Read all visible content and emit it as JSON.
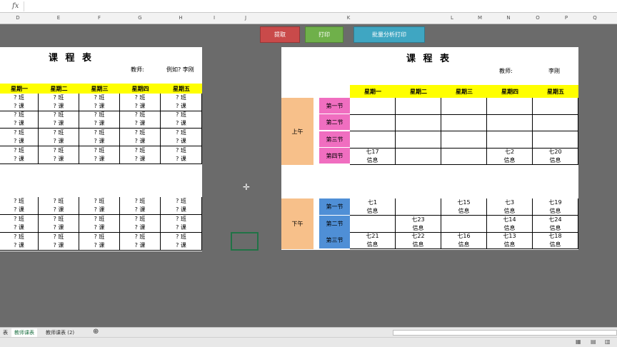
{
  "formula_bar": {
    "fx": "fx"
  },
  "columns": [
    "D",
    "E",
    "F",
    "G",
    "H",
    "I",
    "J",
    "K",
    "L",
    "M",
    "N",
    "O",
    "P",
    "Q"
  ],
  "buttons": [
    {
      "label": "提取",
      "color": "#c94a4a"
    },
    {
      "label": "打印",
      "color": "#6fb04a"
    },
    {
      "label": "批量分析打印",
      "color": "#3fa6c2"
    }
  ],
  "left_sheet": {
    "title": "课 程 表",
    "teacher_label": "教师:",
    "teacher_value": "例如? 李刚",
    "days": [
      "星期一",
      "星期二",
      "星期三",
      "星期四",
      "星期五"
    ],
    "cell_lines": [
      "? 班",
      "? 课"
    ]
  },
  "right_sheet": {
    "title": "课 程 表",
    "teacher_label": "教师:",
    "teacher_value": "李刚",
    "days": [
      "星期一",
      "星期二",
      "星期三",
      "星期四",
      "星期五"
    ],
    "morning_label": "上午",
    "afternoon_label": "下午",
    "morning_periods": [
      "第一节",
      "第二节",
      "第三节",
      "第四节"
    ],
    "afternoon_periods": [
      "第一节",
      "第二节",
      "第三节"
    ],
    "morning_cells": [
      [
        "",
        "",
        "",
        "",
        ""
      ],
      [
        "",
        "",
        "",
        "",
        ""
      ],
      [
        "",
        "",
        "",
        "",
        ""
      ],
      [
        "七17\n信息",
        "",
        "",
        "七2\n信息",
        "七20\n信息"
      ]
    ],
    "afternoon_cells": [
      [
        "七1\n信息",
        "",
        "七15\n信息",
        "七3\n信息",
        "七19\n信息"
      ],
      [
        "",
        "七23\n信息",
        "",
        "七14\n信息",
        "七24\n信息"
      ],
      [
        "七21\n信息",
        "七22\n信息",
        "七16\n信息",
        "七13\n信息",
        "七18\n信息"
      ]
    ]
  },
  "sheet_tabs": [
    "表",
    "教师课表",
    "教师课表 (2)"
  ],
  "colors": {
    "orange": "#f7c08a",
    "pink": "#f06ec0",
    "blue": "#4f8fd6",
    "yellow": "#ffff00"
  }
}
